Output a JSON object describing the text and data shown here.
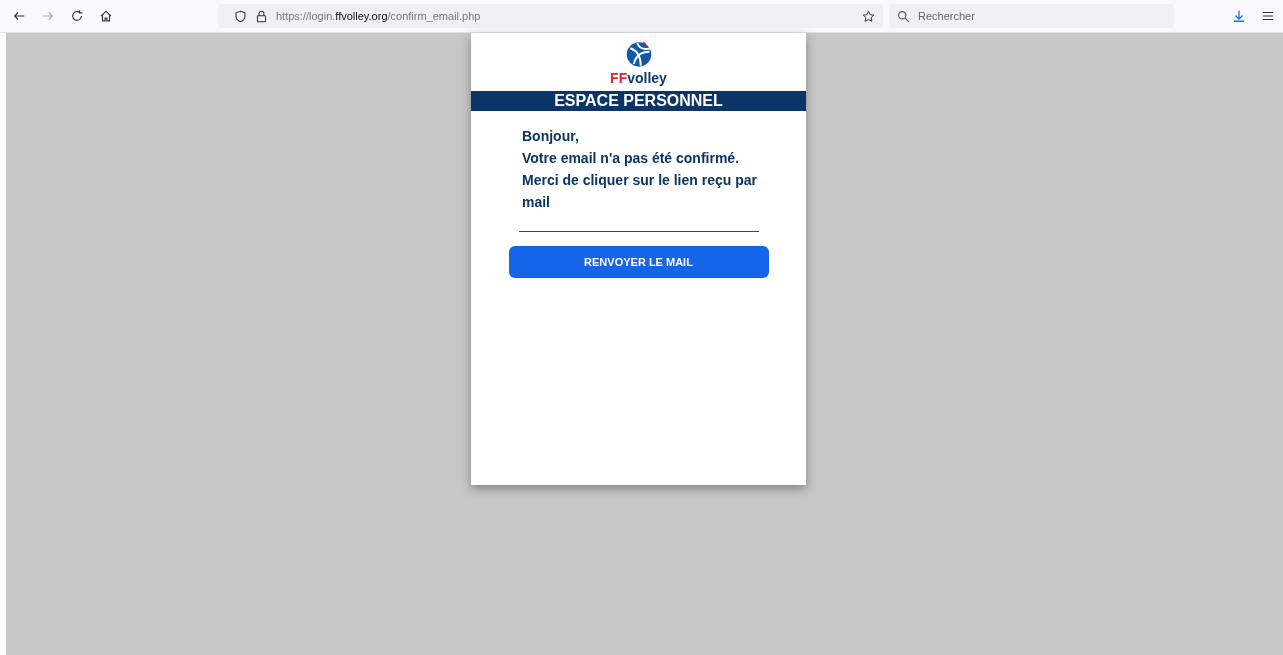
{
  "browser": {
    "url": {
      "prefix": "https://login.",
      "domain": "ffvolley.org",
      "path": "/confirm_email.php"
    },
    "search": {
      "placeholder": "Rechercher"
    }
  },
  "card": {
    "logo": {
      "mark": "FF",
      "name": "volley"
    },
    "banner": "ESPACE PERSONNEL",
    "message": [
      "Bonjour,",
      "Votre email n'a pas été confirmé.",
      "Merci de cliquer sur le lien reçu par mail"
    ],
    "button": "RENVOYER LE MAIL"
  }
}
